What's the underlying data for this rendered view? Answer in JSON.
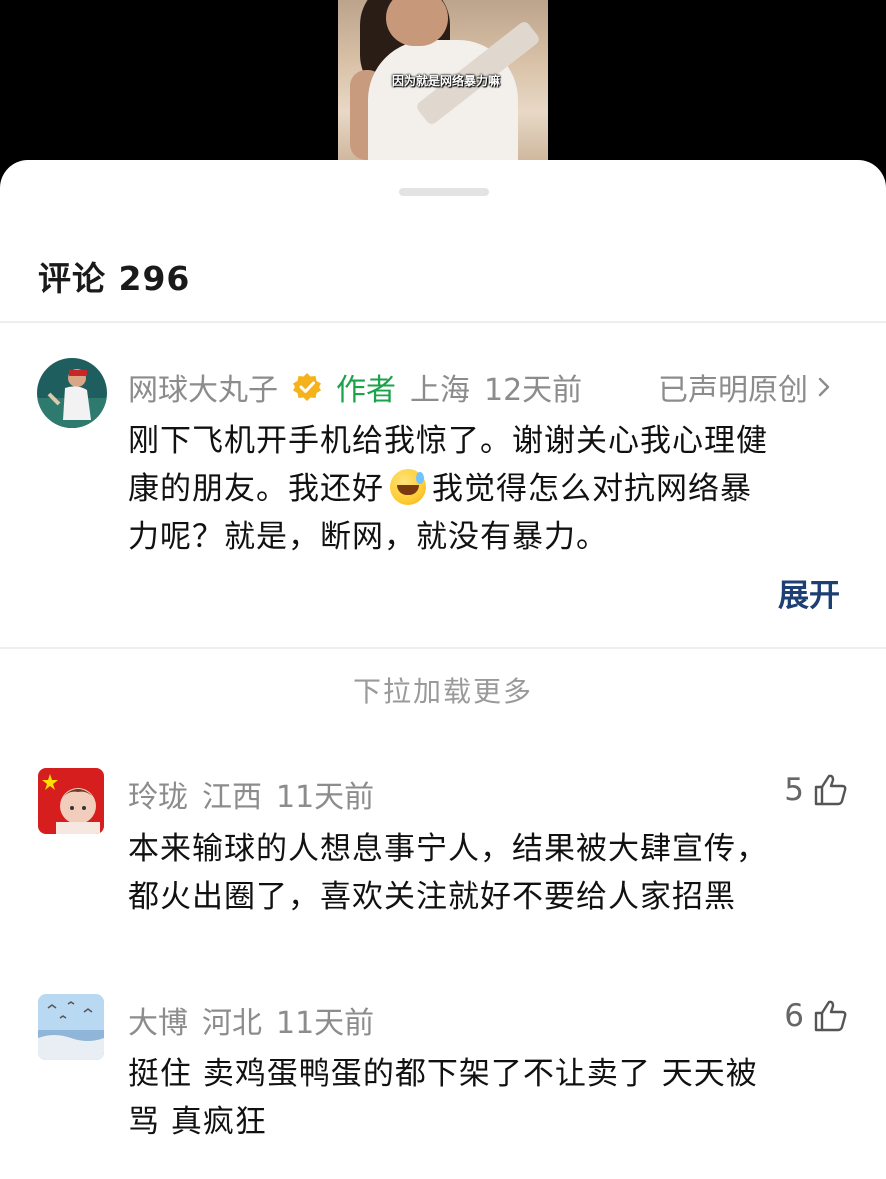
{
  "video": {
    "caption": "因为就是网络暴力嘛"
  },
  "sheet": {
    "title": "评论 296"
  },
  "author_comment": {
    "username": "网球大丸子",
    "author_tag": "作者",
    "location": "上海",
    "time": "12天前",
    "original_notice": "已声明原创",
    "text_line1": "刚下飞机开手机给我惊了。谢谢关心我心理健",
    "text_line2a": "康的朋友。我还好",
    "text_line2b": "我觉得怎么对抗网络暴",
    "text_line3": "力呢？就是，断网，就没有暴力。",
    "expand_label": "展开"
  },
  "load_more": "下拉加载更多",
  "comments": [
    {
      "username": "玲珑",
      "location": "江西",
      "time": "11天前",
      "likes": "5",
      "text_line1": "本来输球的人想息事宁人，结果被大肆宣传，",
      "text_line2": "都火出圈了，喜欢关注就好不要给人家招黑"
    },
    {
      "username": "大博",
      "location": "河北",
      "time": "11天前",
      "likes": "6",
      "text_line1": "挺住 卖鸡蛋鸭蛋的都下架了不让卖了  天天被",
      "text_line2": "骂 真疯狂"
    }
  ],
  "colors": {
    "author_tag": "#1aa34a",
    "expand_link": "#1d3f73",
    "meta_gray": "#8c8c8c"
  },
  "icons": {
    "verified": "verified-badge-icon",
    "chevron": "chevron-right-icon",
    "like": "thumbs-up-icon"
  }
}
